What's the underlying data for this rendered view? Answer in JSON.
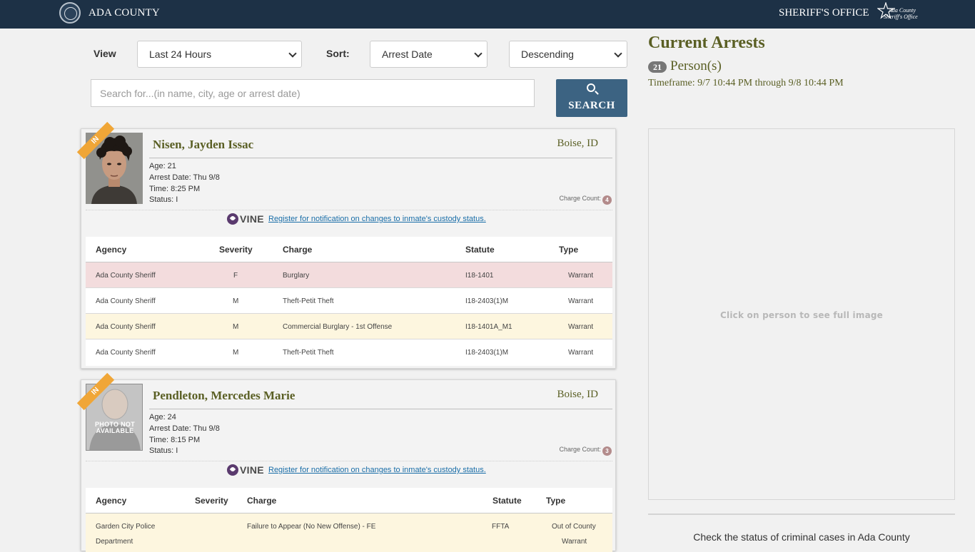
{
  "header": {
    "county_title": "ADA COUNTY",
    "sheriff_title": "SHERIFF'S OFFICE",
    "logo_line1": "Ada County",
    "logo_line2": "Sheriff's Office",
    "bar_color": "#1d3146"
  },
  "filters": {
    "view_label": "View",
    "view_value": "Last 24 Hours",
    "sort_label": "Sort:",
    "sort_value": "Arrest Date",
    "order_value": "Descending",
    "search_placeholder": "Search for...(in name, city, age or arrest date)",
    "search_button": "SEARCH"
  },
  "summary": {
    "title": "Current Arrests",
    "count": "21",
    "persons_label": "Person(s)",
    "timeframe": "Timeframe: 9/7 10:44 PM through 9/8 10:44 PM",
    "image_hint": "Click on person to see full image",
    "court_link": "Check the status of criminal cases in Ada County"
  },
  "vine": {
    "logo_text": "VINE",
    "register_text": " Register for notification on changes to inmate's custody status."
  },
  "table_headers": {
    "agency": "Agency",
    "severity": "Severity",
    "charge": "Charge",
    "statute": "Statute",
    "type": "Type"
  },
  "arrests": [
    {
      "ribbon": "IN",
      "name": "Nisen, Jayden Issac",
      "city": "Boise, ID",
      "age": "Age: 21",
      "arrest_date": "Arrest Date: Thu 9/8",
      "time": "Time: 8:25 PM",
      "status": "Status: I",
      "charge_count_label": "Charge Count:",
      "charge_count": "4",
      "charges": [
        {
          "agency": "Ada County Sheriff",
          "severity": "F",
          "charge": "Burglary",
          "statute": "I18-1401",
          "type": "Warrant",
          "row_color": "#f3dcdd"
        },
        {
          "agency": "Ada County Sheriff",
          "severity": "M",
          "charge": "Theft-Petit Theft",
          "statute": "I18-2403(1)M",
          "type": "Warrant",
          "row_color": "#ffffff"
        },
        {
          "agency": "Ada County Sheriff",
          "severity": "M",
          "charge": "Commercial Burglary - 1st Offense",
          "statute": "I18-1401A_M1",
          "type": "Warrant",
          "row_color": "#fdf6df"
        },
        {
          "agency": "Ada County Sheriff",
          "severity": "M",
          "charge": "Theft-Petit Theft",
          "statute": "I18-2403(1)M",
          "type": "Warrant",
          "row_color": "#ffffff"
        }
      ]
    },
    {
      "ribbon": "IN",
      "name": "Pendleton, Mercedes Marie",
      "city": "Boise, ID",
      "age": "Age: 24",
      "arrest_date": "Arrest Date: Thu 9/8",
      "time": "Time: 8:15 PM",
      "status": "Status: I",
      "charge_count_label": "Charge Count:",
      "charge_count": "3",
      "photo_text": "PHOTO NOT AVAILABLE",
      "charges": [
        {
          "agency_line1": "Garden City Police",
          "agency_line2": "Department",
          "severity": "",
          "charge": "Failure to Appear (No New Offense) - FE",
          "statute": "FFTA",
          "type_line1": "Out of County",
          "type_line2": "Warrant",
          "row_color": "#fdf6df"
        }
      ]
    }
  ]
}
